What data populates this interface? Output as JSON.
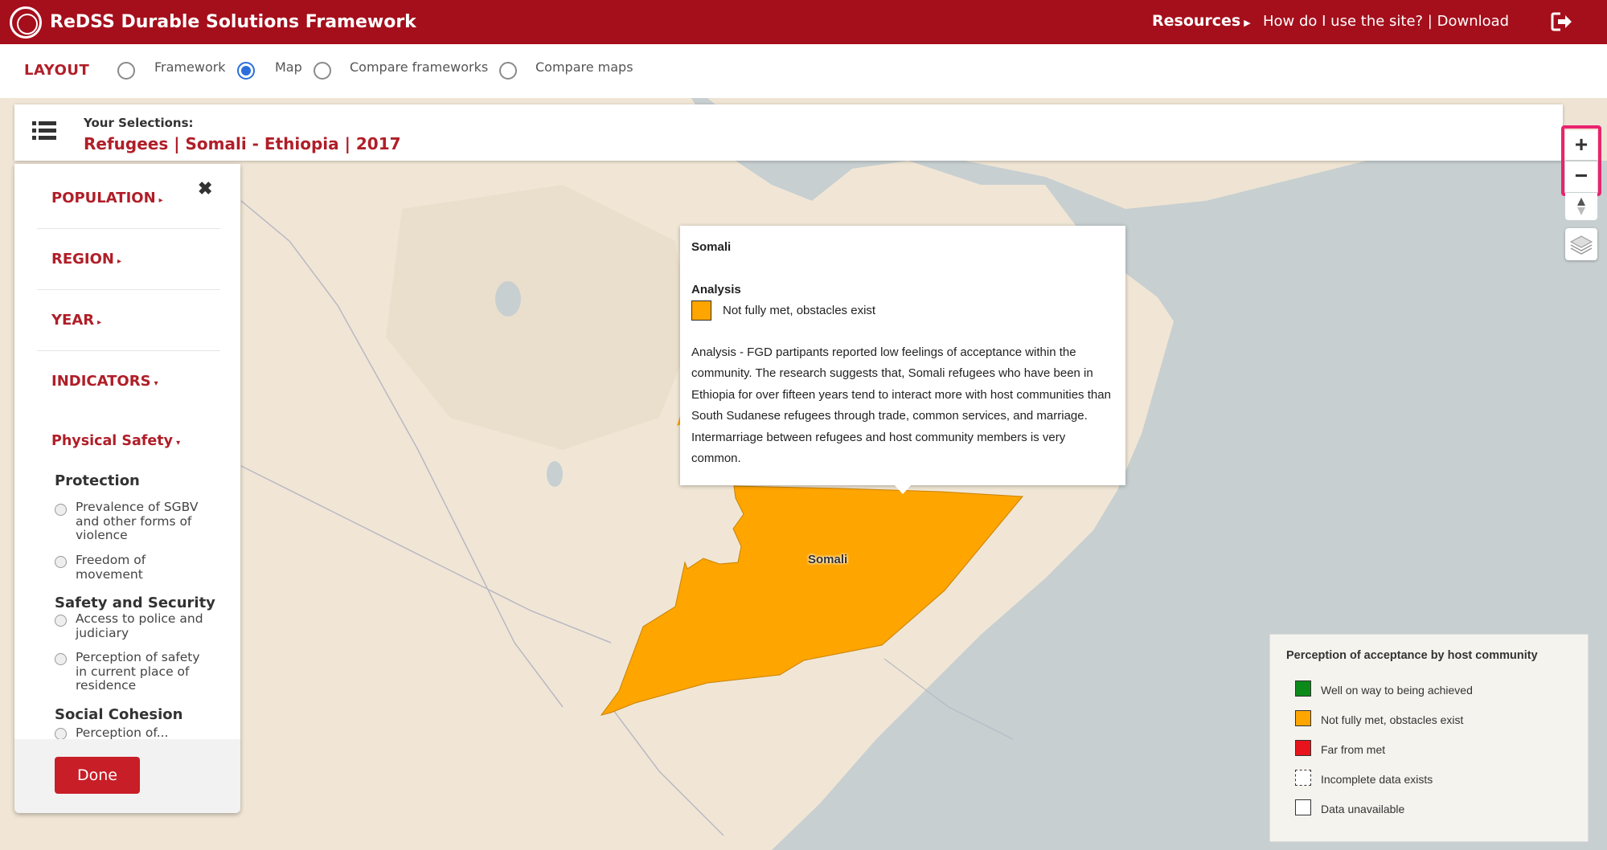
{
  "header": {
    "app_title": "ReDSS Durable Solutions Framework",
    "resources_label": "Resources",
    "help_links": "How do I use the site? | Download",
    "brand_color": "#a50e1b"
  },
  "layout": {
    "label": "LAYOUT",
    "options": [
      {
        "label": "Framework",
        "checked": false
      },
      {
        "label": "Map",
        "checked": true
      },
      {
        "label": "Compare frameworks",
        "checked": false
      },
      {
        "label": "Compare maps",
        "checked": false
      }
    ]
  },
  "selections": {
    "label": "Your Selections:",
    "value": "Refugees | Somali - Ethiopia | 2017"
  },
  "map_controls": {
    "zoom_in": "+",
    "zoom_out": "−"
  },
  "panel": {
    "close": "✖",
    "menu": [
      {
        "label": "POPULATION",
        "caret": "▸"
      },
      {
        "label": "REGION",
        "caret": "▸"
      },
      {
        "label": "YEAR",
        "caret": "▸"
      },
      {
        "label": "INDICATORS",
        "caret": "▾"
      },
      {
        "label": "Physical Safety",
        "caret": "▾"
      }
    ],
    "groups": [
      {
        "heading": "Protection",
        "options": [
          "Prevalence of SGBV and other forms of violence",
          "Freedom of movement"
        ]
      },
      {
        "heading": "Safety and Security",
        "options": [
          "Access to police and judiciary",
          "Perception of safety in current place of residence"
        ]
      },
      {
        "heading": "Social Cohesion",
        "options": [
          "Perception of..."
        ]
      }
    ],
    "done_label": "Done"
  },
  "popup": {
    "title": "Somali",
    "subtitle": "Analysis",
    "status": "Not fully met, obstacles exist",
    "status_color": "#fea500",
    "text": "Analysis - FGD partipants reported low feelings of acceptance within the community. The research suggests that, Somali refugees who have been in Ethiopia for over fifteen years tend to interact more with host communities than South Sudanese refugees through trade, common services, and marriage. Intermarriage between refugees and host community members is very common."
  },
  "map": {
    "region_label": "Somali",
    "region_color": "#fea500",
    "land_color": "#f1e6d5",
    "water_color": "#c7cfd1"
  },
  "legend": {
    "title": "Perception of acceptance by host community",
    "items": [
      {
        "label": "Well on way to being achieved",
        "color": "#0b8a1a"
      },
      {
        "label": "Not fully met, obstacles exist",
        "color": "#fea500"
      },
      {
        "label": "Far from met",
        "color": "#e8141b"
      },
      {
        "label": "Incomplete data exists",
        "color": "#ffffff"
      },
      {
        "label": "Data unavailable",
        "color": "#ffffff"
      }
    ]
  }
}
